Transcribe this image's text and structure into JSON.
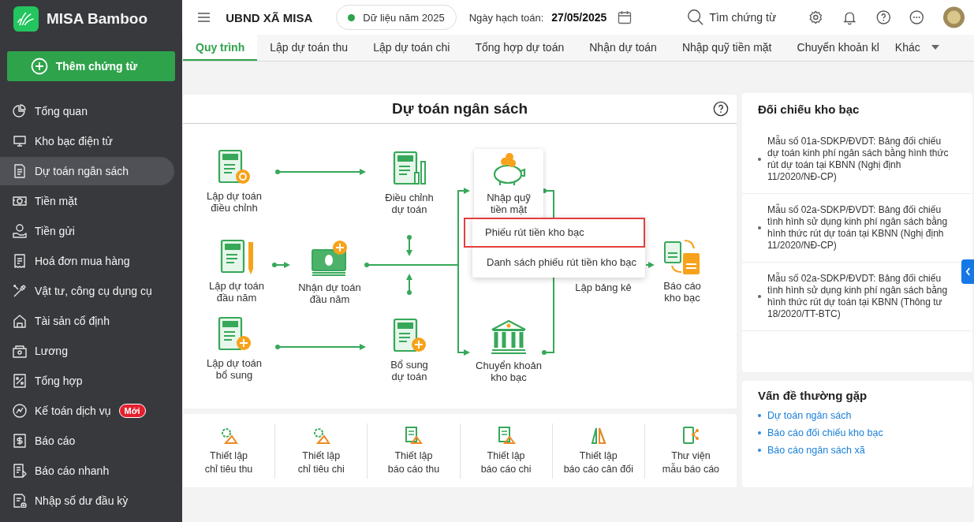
{
  "app": {
    "name": "MISA Bamboo",
    "add_button": "Thêm chứng từ"
  },
  "sidebar": {
    "items": [
      {
        "label": "Tổng quan",
        "selected": false
      },
      {
        "label": "Kho bạc điện tử",
        "selected": false
      },
      {
        "label": "Dự toán ngân sách",
        "selected": true
      },
      {
        "label": "Tiền mặt",
        "selected": false
      },
      {
        "label": "Tiền gửi",
        "selected": false
      },
      {
        "label": "Hoá đơn mua hàng",
        "selected": false
      },
      {
        "label": "Vật tư, công cụ dụng cụ",
        "selected": false
      },
      {
        "label": "Tài sản cố định",
        "selected": false
      },
      {
        "label": "Lương",
        "selected": false
      },
      {
        "label": "Tổng hợp",
        "selected": false
      },
      {
        "label": "Kế toán dịch vụ",
        "selected": false,
        "badge": "Mới"
      },
      {
        "label": "Báo cáo",
        "selected": false
      },
      {
        "label": "Báo cáo nhanh",
        "selected": false
      },
      {
        "label": "Nhập số dư đầu kỳ",
        "selected": false
      }
    ]
  },
  "header": {
    "organization": "UBND XÃ MISA",
    "data_year": "Dữ liệu năm 2025",
    "posting_date_label": "Ngày hạch toán:",
    "posting_date": "27/05/2025",
    "search_placeholder": "Tìm chứng từ"
  },
  "tabs": [
    {
      "label": "Quy trình",
      "selected": true
    },
    {
      "label": "Lập dự toán thu",
      "selected": false
    },
    {
      "label": "Lập dự toán chi",
      "selected": false
    },
    {
      "label": "Tổng hợp dự toán",
      "selected": false
    },
    {
      "label": "Nhận dự toán",
      "selected": false
    },
    {
      "label": "Nhập quỹ tiền mặt",
      "selected": false
    },
    {
      "label": "Chuyển khoản kl",
      "selected": false
    }
  ],
  "more_tab": "Khác",
  "budget_flow": {
    "title": "Dự toán ngân sách",
    "nodes": [
      {
        "lines": [
          "Lập dự toán",
          "điều chỉnh"
        ],
        "active": false
      },
      {
        "lines": [
          "Điều chỉnh",
          "dự toán"
        ],
        "active": false
      },
      {
        "lines": [
          "Nhập quỹ",
          "tiền mặt"
        ],
        "active": true
      },
      {
        "lines": [
          "Lập dự toán",
          "đầu năm"
        ],
        "active": false
      },
      {
        "lines": [
          "Nhận dự toán",
          "đầu năm"
        ],
        "active": false
      },
      {
        "lines": [
          "Lập bảng kê"
        ],
        "active": false
      },
      {
        "lines": [
          "Báo cáo",
          "kho bạc"
        ],
        "active": false
      },
      {
        "lines": [
          "Lập dự toán",
          "bổ sung"
        ],
        "active": false
      },
      {
        "lines": [
          "Bổ sung",
          "dự toán"
        ],
        "active": false
      },
      {
        "lines": [
          "Chuyển khoản",
          "kho bạc"
        ],
        "active": false
      }
    ],
    "menu": [
      {
        "label": "Phiếu rút tiền kho bạc",
        "highlighted": true
      },
      {
        "label": "Danh sách phiếu rút tiền kho bạc",
        "highlighted": false
      }
    ]
  },
  "setup_items": [
    {
      "lines": [
        "Thiết lập",
        "chỉ tiêu thu"
      ]
    },
    {
      "lines": [
        "Thiết lập",
        "chỉ tiêu chi"
      ]
    },
    {
      "lines": [
        "Thiết lập",
        "báo cáo thu"
      ]
    },
    {
      "lines": [
        "Thiết lập",
        "báo cáo chi"
      ]
    },
    {
      "lines": [
        "Thiết lập",
        "báo cáo cân đối"
      ]
    },
    {
      "lines": [
        "Thư viện",
        "mẫu báo cáo"
      ]
    }
  ],
  "treasury_reconciliation": {
    "title": "Đối chiếu kho bạc",
    "items": [
      "Mẫu số 01a-SDKP/ĐVDT: Bảng đối chiếu dự toán kinh phí ngân sách bằng hình thức rút dự toán tại KBNN (Nghị định 11/2020/NĐ-CP)",
      "Mẫu số 02a-SDKP/ĐVDT: Bảng đối chiếu tình hình sử dụng kinh phí ngân sách bằng hình thức rút dự toán tại KBNN (Nghị định 11/2020/NĐ-CP)",
      "Mẫu số 02a-SDKP/ĐVDT: Bảng đối chiếu tình hình sử dụng kinh phí ngân sách bằng hình thức rút dự toán tại KBNN (Thông tư 18/2020/TT-BTC)"
    ]
  },
  "common_issues": {
    "title": "Vấn đề thường gặp",
    "links": [
      "Dự toán ngân sách",
      "Báo cáo đối chiếu kho bạc",
      "Báo cáo ngân sách xã"
    ]
  }
}
